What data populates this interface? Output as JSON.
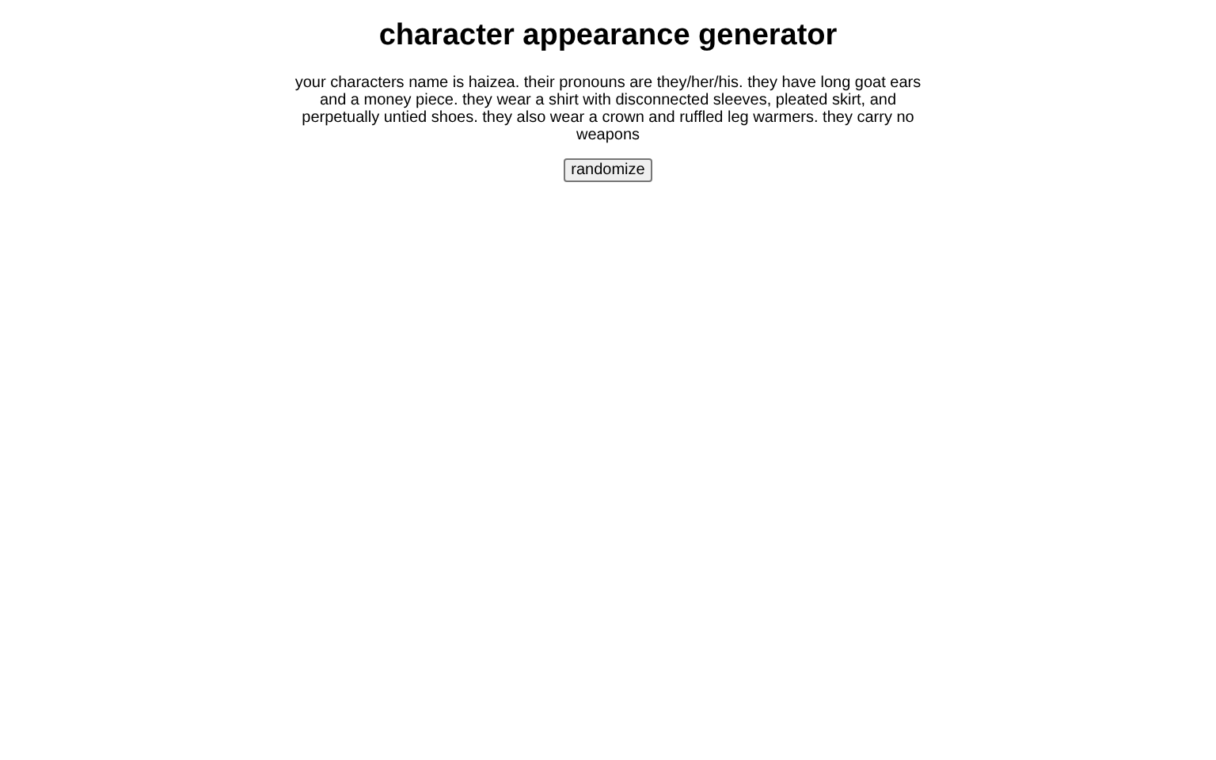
{
  "title": "character appearance generator",
  "description": "your characters name is haizea. their pronouns are they/her/his. they have long goat ears and a money piece. they wear a shirt with disconnected sleeves, pleated skirt, and perpetually untied shoes. they also wear a crown and ruffled leg warmers. they carry no weapons",
  "button": "randomize"
}
